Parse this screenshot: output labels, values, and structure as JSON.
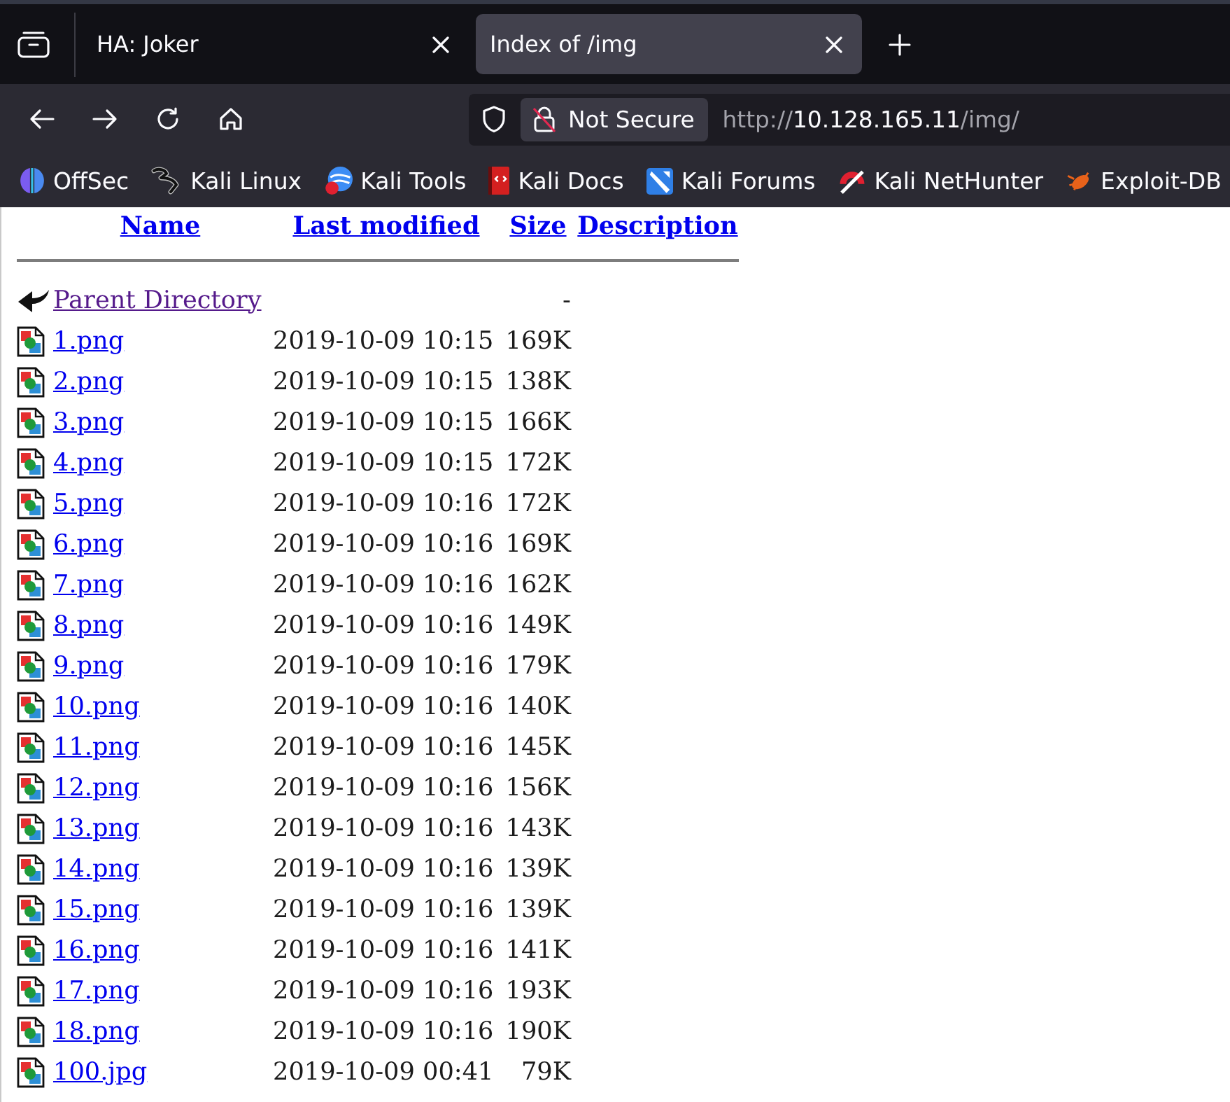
{
  "browser": {
    "tabs": [
      {
        "title": "HA: Joker",
        "selected": false
      },
      {
        "title": "Index of /img",
        "selected": true
      }
    ],
    "address_bar": {
      "security_label": "Not Secure",
      "url_scheme": "http://",
      "url_host": "10.128.165.11",
      "url_path": "/img/"
    },
    "bookmarks": [
      {
        "label": "OffSec",
        "kind": "offsec"
      },
      {
        "label": "Kali Linux",
        "kind": "kali_linux"
      },
      {
        "label": "Kali Tools",
        "kind": "kali_tools"
      },
      {
        "label": "Kali Docs",
        "kind": "kali_docs"
      },
      {
        "label": "Kali Forums",
        "kind": "kali_forums"
      },
      {
        "label": "Kali NetHunter",
        "kind": "nethunter"
      },
      {
        "label": "Exploit-DB",
        "kind": "exploit_db"
      }
    ]
  },
  "listing": {
    "columns": [
      "Name",
      "Last modified",
      "Size",
      "Description"
    ],
    "entries": [
      {
        "kind": "parent",
        "name": "Parent Directory",
        "size": "-",
        "visited": true
      },
      {
        "kind": "image",
        "name": "1.png",
        "modified": "2019-10-09 10:15",
        "size": "169K",
        "visited": false
      },
      {
        "kind": "image",
        "name": "2.png",
        "modified": "2019-10-09 10:15",
        "size": "138K",
        "visited": false
      },
      {
        "kind": "image",
        "name": "3.png",
        "modified": "2019-10-09 10:15",
        "size": "166K",
        "visited": false
      },
      {
        "kind": "image",
        "name": "4.png",
        "modified": "2019-10-09 10:15",
        "size": "172K",
        "visited": false
      },
      {
        "kind": "image",
        "name": "5.png",
        "modified": "2019-10-09 10:16",
        "size": "172K",
        "visited": false
      },
      {
        "kind": "image",
        "name": "6.png",
        "modified": "2019-10-09 10:16",
        "size": "169K",
        "visited": false
      },
      {
        "kind": "image",
        "name": "7.png",
        "modified": "2019-10-09 10:16",
        "size": "162K",
        "visited": false
      },
      {
        "kind": "image",
        "name": "8.png",
        "modified": "2019-10-09 10:16",
        "size": "149K",
        "visited": false
      },
      {
        "kind": "image",
        "name": "9.png",
        "modified": "2019-10-09 10:16",
        "size": "179K",
        "visited": false
      },
      {
        "kind": "image",
        "name": "10.png",
        "modified": "2019-10-09 10:16",
        "size": "140K",
        "visited": false
      },
      {
        "kind": "image",
        "name": "11.png",
        "modified": "2019-10-09 10:16",
        "size": "145K",
        "visited": false
      },
      {
        "kind": "image",
        "name": "12.png",
        "modified": "2019-10-09 10:16",
        "size": "156K",
        "visited": false
      },
      {
        "kind": "image",
        "name": "13.png",
        "modified": "2019-10-09 10:16",
        "size": "143K",
        "visited": false
      },
      {
        "kind": "image",
        "name": "14.png",
        "modified": "2019-10-09 10:16",
        "size": "139K",
        "visited": false
      },
      {
        "kind": "image",
        "name": "15.png",
        "modified": "2019-10-09 10:16",
        "size": "139K",
        "visited": false
      },
      {
        "kind": "image",
        "name": "16.png",
        "modified": "2019-10-09 10:16",
        "size": "141K",
        "visited": false
      },
      {
        "kind": "image",
        "name": "17.png",
        "modified": "2019-10-09 10:16",
        "size": "193K",
        "visited": false
      },
      {
        "kind": "image",
        "name": "18.png",
        "modified": "2019-10-09 10:16",
        "size": "190K",
        "visited": false
      },
      {
        "kind": "image",
        "name": "100.jpg",
        "modified": "2019-10-09 00:41",
        "size": "79K",
        "visited": false
      }
    ]
  }
}
